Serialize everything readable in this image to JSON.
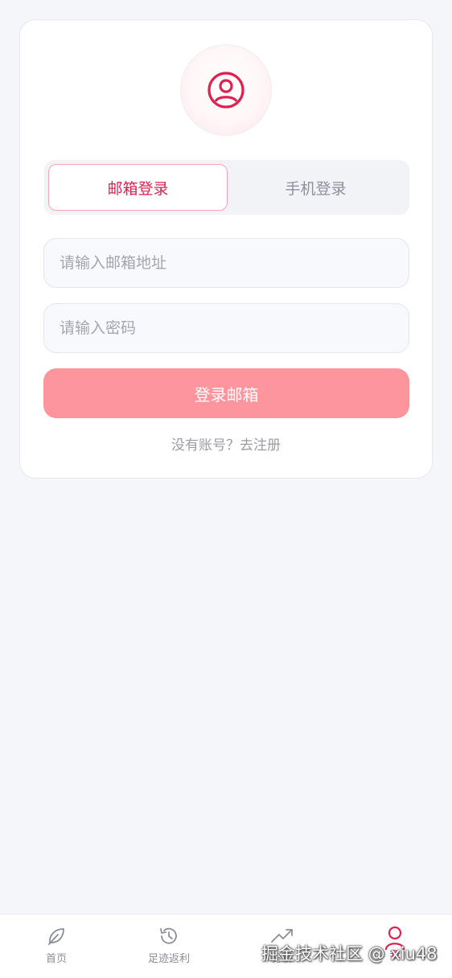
{
  "login": {
    "tabs": [
      {
        "label": "邮箱登录",
        "active": true
      },
      {
        "label": "手机登录",
        "active": false
      }
    ],
    "email_placeholder": "请输入邮箱地址",
    "password_placeholder": "请输入密码",
    "submit_label": "登录邮箱",
    "register_text": "没有账号？去注册"
  },
  "bottom_nav": {
    "items": [
      {
        "label": "首页",
        "icon": "leaf-icon"
      },
      {
        "label": "足迹返利",
        "icon": "history-icon"
      },
      {
        "label": "分析",
        "icon": "trending-up-icon"
      },
      {
        "label": "我",
        "icon": "user-icon",
        "active": true
      }
    ]
  },
  "watermark": "掘金技术社区 @ xiu48",
  "colors": {
    "accent": "#e0214f",
    "button": "#fd959d",
    "background": "#f5f6fa"
  }
}
